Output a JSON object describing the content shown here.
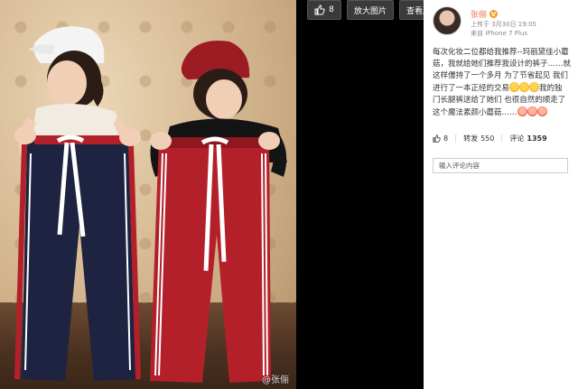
{
  "toolbar": {
    "like_count": "8",
    "enlarge_label": "放大图片",
    "original_label": "查看原图"
  },
  "author": {
    "name": "张俪",
    "meta_line1": "上传于 3月30日 19:05",
    "meta_line2": "来自 iPhone 7 Plus"
  },
  "post": {
    "text_lines": [
      "每次化妆二位都给我推荐--玛丽黛佳小蘑",
      "菇，我就给她们推荐我设计的裤子……就",
      "这样僵持了一个多月 为了节省起见 我们",
      "进行了一本正经的交易",
      "我的独",
      "门长腿裤送给了她们 也很自然的顺走了",
      "这个魔法素颜小蘑菇……"
    ]
  },
  "actions": {
    "like_count": "8",
    "repost_label": "转发",
    "repost_count": "550",
    "comment_label": "评论",
    "comment_count": "1359"
  },
  "comment_input": {
    "placeholder": "输入评论内容"
  },
  "photo": {
    "watermark": "@张俪"
  },
  "colors": {
    "accent": "#eb7350",
    "badge": "#f59c1a",
    "pants_navy": "#1d2340",
    "pants_red": "#b4202a"
  }
}
